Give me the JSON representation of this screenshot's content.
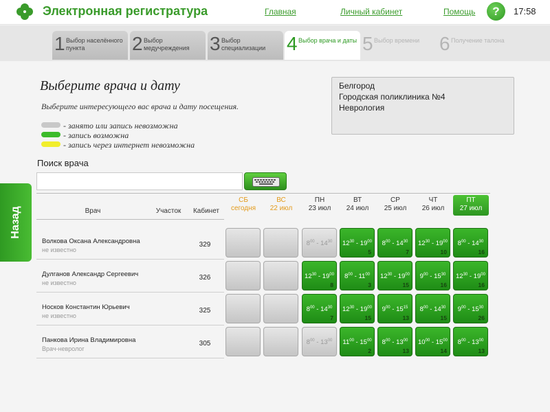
{
  "header": {
    "title": "Электронная регистратура",
    "nav": {
      "home": "Главная",
      "cabinet": "Личный кабинет",
      "help": "Помощь"
    },
    "help_icon_label": "?",
    "time": "17:58",
    "logo_icon": "clover-icon",
    "brand_color": "#3a9b2b"
  },
  "steps": [
    {
      "num": "1",
      "label": "Выбор населённого пункта",
      "state": "done"
    },
    {
      "num": "2",
      "label": "Выбор медучреждения",
      "state": "done"
    },
    {
      "num": "3",
      "label": "Выбор специализации",
      "state": "done"
    },
    {
      "num": "4",
      "label": "Выбор врача и даты",
      "state": "active"
    },
    {
      "num": "5",
      "label": "Выбор времени",
      "state": "future"
    },
    {
      "num": "6",
      "label": "Получение талона",
      "state": "future"
    }
  ],
  "main": {
    "title": "Выберите врача и дату",
    "subtitle": "Выберите интересующего вас врача и дату посещения.",
    "legend": [
      {
        "color": "#c8c8c8",
        "text": "- занято или запись невозможна"
      },
      {
        "color": "#3cbb2a",
        "text": "- запись возможна"
      },
      {
        "color": "#f1ee2c",
        "text": "- запись через интернет невозможна"
      }
    ],
    "info": {
      "city": "Белгород",
      "clinic": "Городская поликлиника №4",
      "specialty": "Неврология"
    },
    "search": {
      "label": "Поиск врача",
      "value": "",
      "placeholder": "",
      "keyboard_icon": "keyboard-icon"
    },
    "back_label": "Назад"
  },
  "table": {
    "headers": {
      "doctor": "Врач",
      "area": "Участок",
      "cabinet": "Кабинет"
    },
    "days": [
      {
        "dow": "СБ",
        "date": "сегодня",
        "weekend": true
      },
      {
        "dow": "ВС",
        "date": "22 июл",
        "weekend": true
      },
      {
        "dow": "ПН",
        "date": "23 июл",
        "weekend": false
      },
      {
        "dow": "ВТ",
        "date": "24 июл",
        "weekend": false
      },
      {
        "dow": "СР",
        "date": "25 июл",
        "weekend": false
      },
      {
        "dow": "ЧТ",
        "date": "26 июл",
        "weekend": false
      },
      {
        "dow": "ПТ",
        "date": "27 июл",
        "weekend": false,
        "selected": true
      }
    ],
    "rows": [
      {
        "name": "Волкова Оксана Александровна",
        "area": "не известно",
        "cabinet": "329",
        "cells": [
          {
            "state": "gray",
            "start": "",
            "start_min": "",
            "end": "",
            "end_min": "",
            "slots": ""
          },
          {
            "state": "gray",
            "start": "",
            "start_min": "",
            "end": "",
            "end_min": "",
            "slots": ""
          },
          {
            "state": "gray",
            "start": "8",
            "start_min": "00",
            "end": "14",
            "end_min": "30",
            "slots": ""
          },
          {
            "state": "green",
            "start": "12",
            "start_min": "30",
            "end": "19",
            "end_min": "00",
            "slots": "5"
          },
          {
            "state": "green",
            "start": "8",
            "start_min": "00",
            "end": "14",
            "end_min": "30",
            "slots": "7"
          },
          {
            "state": "green",
            "start": "12",
            "start_min": "30",
            "end": "19",
            "end_min": "00",
            "slots": "10"
          },
          {
            "state": "green",
            "start": "8",
            "start_min": "00",
            "end": "14",
            "end_min": "30",
            "slots": "16"
          }
        ]
      },
      {
        "name": "Дулганов Александр Сергеевич",
        "area": "не известно",
        "cabinet": "326",
        "cells": [
          {
            "state": "gray",
            "start": "",
            "start_min": "",
            "end": "",
            "end_min": "",
            "slots": ""
          },
          {
            "state": "gray",
            "start": "",
            "start_min": "",
            "end": "",
            "end_min": "",
            "slots": ""
          },
          {
            "state": "green",
            "start": "12",
            "start_min": "30",
            "end": "19",
            "end_min": "00",
            "slots": "8"
          },
          {
            "state": "green",
            "start": "8",
            "start_min": "00",
            "end": "11",
            "end_min": "00",
            "slots": "3"
          },
          {
            "state": "green",
            "start": "12",
            "start_min": "30",
            "end": "19",
            "end_min": "00",
            "slots": "15"
          },
          {
            "state": "green",
            "start": "9",
            "start_min": "00",
            "end": "15",
            "end_min": "30",
            "slots": "16"
          },
          {
            "state": "green",
            "start": "12",
            "start_min": "30",
            "end": "19",
            "end_min": "00",
            "slots": "16"
          }
        ]
      },
      {
        "name": "Носков Константин Юрьевич",
        "area": "не известно",
        "cabinet": "325",
        "cells": [
          {
            "state": "gray",
            "start": "",
            "start_min": "",
            "end": "",
            "end_min": "",
            "slots": ""
          },
          {
            "state": "gray",
            "start": "",
            "start_min": "",
            "end": "",
            "end_min": "",
            "slots": ""
          },
          {
            "state": "green",
            "start": "8",
            "start_min": "00",
            "end": "14",
            "end_min": "30",
            "slots": "7"
          },
          {
            "state": "green",
            "start": "12",
            "start_min": "30",
            "end": "19",
            "end_min": "00",
            "slots": "15"
          },
          {
            "state": "green",
            "start": "9",
            "start_min": "00",
            "end": "15",
            "end_min": "15",
            "slots": "13"
          },
          {
            "state": "green",
            "start": "8",
            "start_min": "00",
            "end": "14",
            "end_min": "30",
            "slots": "15"
          },
          {
            "state": "green",
            "start": "9",
            "start_min": "00",
            "end": "15",
            "end_min": "30",
            "slots": "26"
          }
        ]
      },
      {
        "name": "Панкова Ирина Владимировна",
        "area": "Врач-невролог",
        "cabinet": "305",
        "cells": [
          {
            "state": "gray",
            "start": "",
            "start_min": "",
            "end": "",
            "end_min": "",
            "slots": ""
          },
          {
            "state": "gray",
            "start": "",
            "start_min": "",
            "end": "",
            "end_min": "",
            "slots": ""
          },
          {
            "state": "gray",
            "start": "8",
            "start_min": "00",
            "end": "13",
            "end_min": "00",
            "slots": ""
          },
          {
            "state": "green",
            "start": "11",
            "start_min": "00",
            "end": "15",
            "end_min": "00",
            "slots": "2"
          },
          {
            "state": "green",
            "start": "8",
            "start_min": "00",
            "end": "13",
            "end_min": "00",
            "slots": "13"
          },
          {
            "state": "green",
            "start": "10",
            "start_min": "00",
            "end": "15",
            "end_min": "00",
            "slots": "14"
          },
          {
            "state": "green",
            "start": "8",
            "start_min": "00",
            "end": "13",
            "end_min": "00",
            "slots": "13"
          }
        ]
      }
    ]
  }
}
